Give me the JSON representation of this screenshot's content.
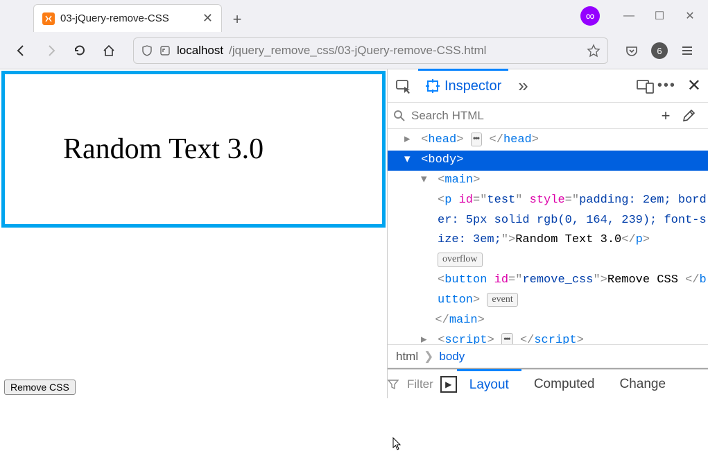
{
  "tab": {
    "title": "03-jQuery-remove-CSS"
  },
  "address": {
    "host": "localhost",
    "path": "/jquery_remove_css/03-jQuery-remove-CSS.html"
  },
  "page": {
    "text": "Random Text 3.0",
    "button": "Remove CSS"
  },
  "devtools": {
    "inspector_label": "Inspector",
    "search_placeholder": "Search HTML",
    "crumbs": {
      "html": "html",
      "body": "body"
    },
    "bottom": {
      "filter": "Filter",
      "layout": "Layout",
      "computed": "Computed",
      "changes": "Change"
    },
    "dom": {
      "head": "head",
      "body": "body",
      "main": "main",
      "p_open": "<p id=\"test\" style=\"padding: 2em; border: 5px solid rgb(0, 164, 239); font-size: 3em;\">",
      "p_text": "Random Text 3.0",
      "p_close": "</p",
      "overflow": "overflow",
      "btn_open": "<button id=\"remove_css\">",
      "btn_text": "Remove CSS",
      "btn_close": "button",
      "event": "event",
      "main_close": "main",
      "script": "script"
    }
  },
  "badge": "6"
}
